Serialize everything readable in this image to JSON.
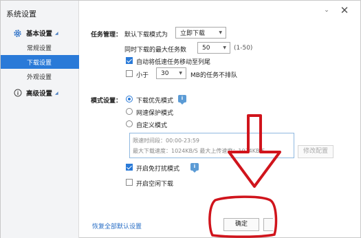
{
  "window": {
    "title": "系统设置",
    "close_icon": "close-icon",
    "menu_icon": "chevron-down-icon"
  },
  "sidebar": {
    "sections": [
      {
        "label": "基本设置",
        "icon": "gear-icon"
      },
      {
        "label": "高级设置",
        "icon": "info-icon"
      }
    ],
    "items": [
      {
        "label": "常规设置",
        "active": false
      },
      {
        "label": "下载设置",
        "active": true
      },
      {
        "label": "外观设置",
        "active": false
      }
    ]
  },
  "task": {
    "heading": "任务管理：",
    "default_mode_label": "默认下载模式为",
    "default_mode_value": "立即下载",
    "max_tasks_label": "同时下载的最大任务数",
    "max_tasks_value": "50",
    "max_tasks_range": "(1-50)",
    "auto_move_label": "自动将低速任务移动至列尾",
    "auto_move_checked": true,
    "less_than_prefix": "小于",
    "less_than_value": "30",
    "less_than_suffix": "MB的任务不排队",
    "less_than_checked": false
  },
  "mode": {
    "heading": "模式设置：",
    "options": [
      {
        "label": "下载优先模式",
        "selected": true
      },
      {
        "label": "网速保护模式",
        "selected": false
      },
      {
        "label": "自定义模式",
        "selected": false
      }
    ],
    "custom_time": "限速时间段：00:00-23:59",
    "custom_speeds": "最大下载速度：1024KB/S  最大上传速度：1024KB/S",
    "modify_button": "修改配置",
    "dnd_label": "开启免打扰模式",
    "dnd_checked": true,
    "idle_label": "开启空闲下载",
    "idle_checked": false
  },
  "footer": {
    "restore_link": "恢复全部默认设置",
    "ok_button": "确定"
  },
  "annotations": {
    "color": "#d0141c"
  }
}
